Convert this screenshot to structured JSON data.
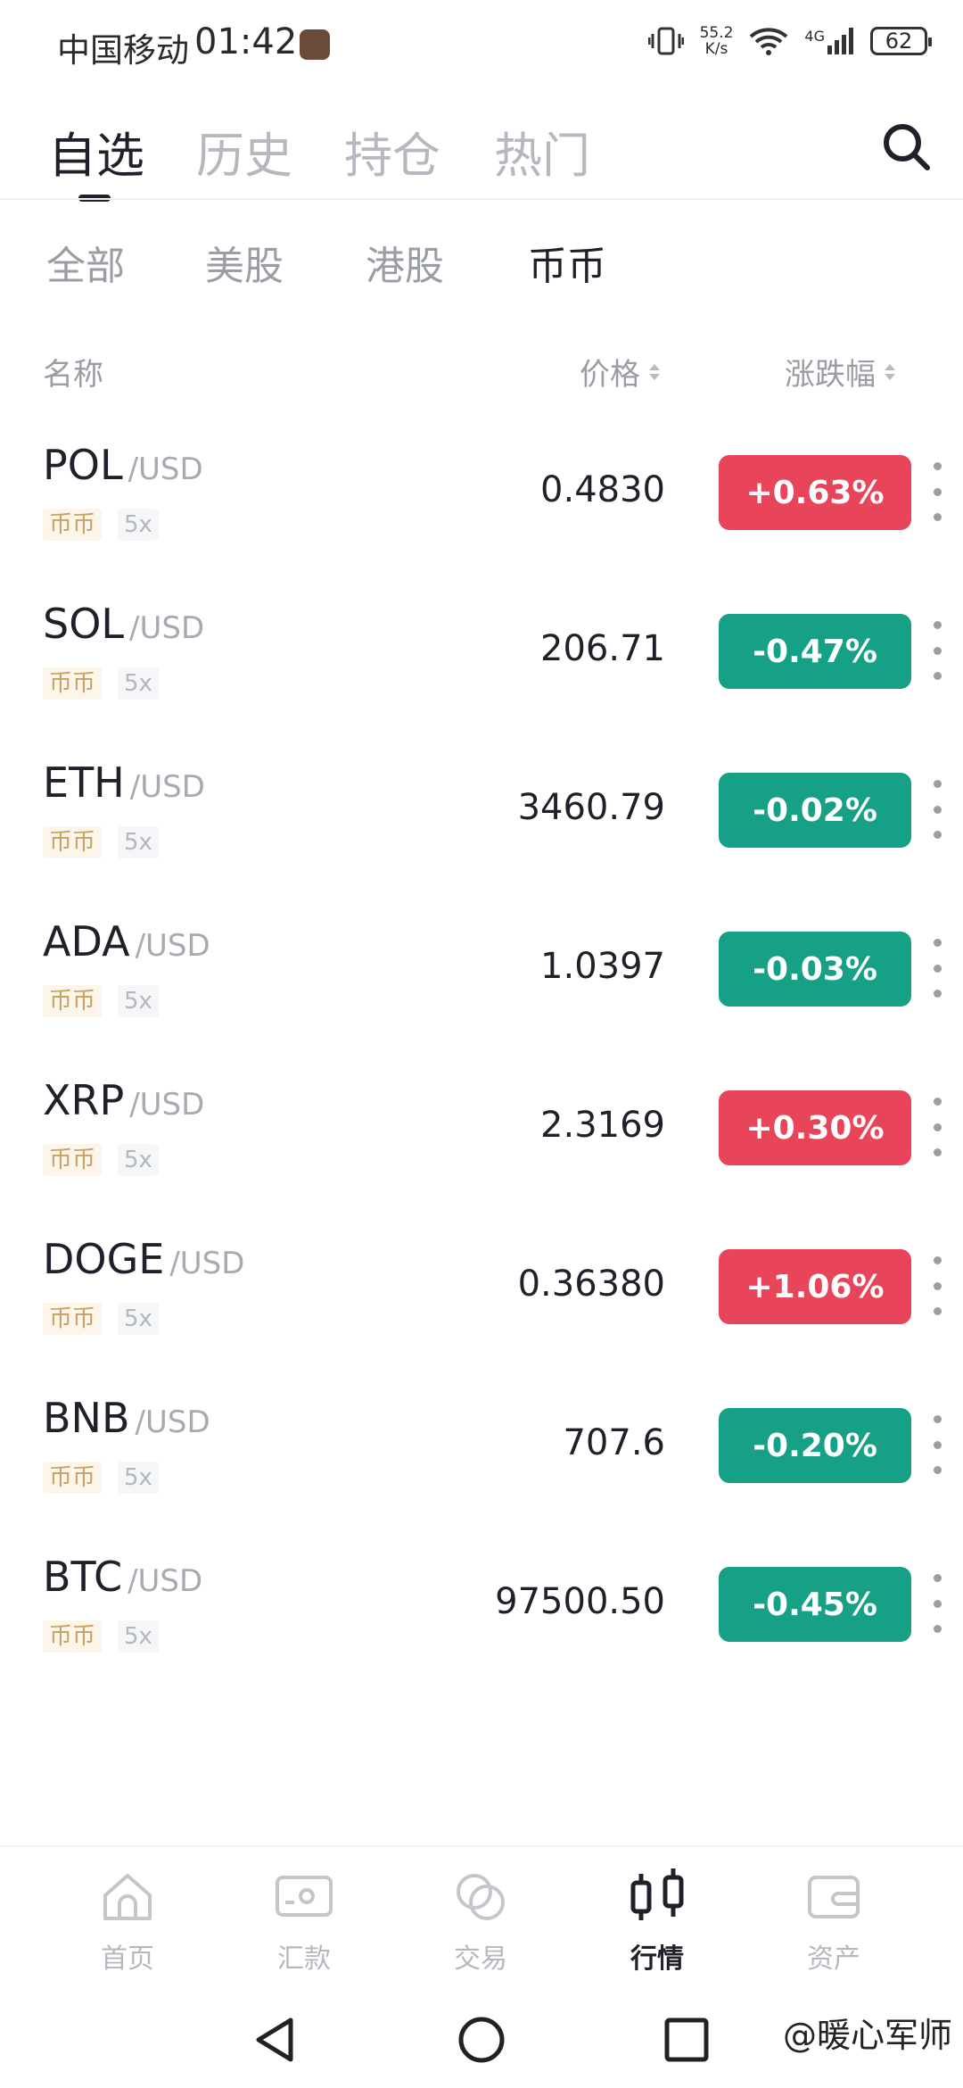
{
  "status_bar": {
    "carrier": "中国移动",
    "time": "01:42",
    "net_speed_value": "55.2",
    "net_speed_unit": "K/s",
    "network": "4G",
    "battery": "62"
  },
  "main_tabs": [
    {
      "label": "自选",
      "active": true
    },
    {
      "label": "历史",
      "active": false
    },
    {
      "label": "持仓",
      "active": false
    },
    {
      "label": "热门",
      "active": false
    }
  ],
  "sub_tabs": [
    {
      "label": "全部",
      "active": false
    },
    {
      "label": "美股",
      "active": false
    },
    {
      "label": "港股",
      "active": false
    },
    {
      "label": "币币",
      "active": true
    }
  ],
  "list_header": {
    "name": "名称",
    "price": "价格",
    "change": "涨跌幅"
  },
  "rows": [
    {
      "symbol": "POL",
      "quote": "/USD",
      "category": "币币",
      "leverage": "5x",
      "price": "0.4830",
      "change": "+0.63%",
      "direction": "up"
    },
    {
      "symbol": "SOL",
      "quote": "/USD",
      "category": "币币",
      "leverage": "5x",
      "price": "206.71",
      "change": "-0.47%",
      "direction": "down"
    },
    {
      "symbol": "ETH",
      "quote": "/USD",
      "category": "币币",
      "leverage": "5x",
      "price": "3460.79",
      "change": "-0.02%",
      "direction": "down"
    },
    {
      "symbol": "ADA",
      "quote": "/USD",
      "category": "币币",
      "leverage": "5x",
      "price": "1.0397",
      "change": "-0.03%",
      "direction": "down"
    },
    {
      "symbol": "XRP",
      "quote": "/USD",
      "category": "币币",
      "leverage": "5x",
      "price": "2.3169",
      "change": "+0.30%",
      "direction": "up"
    },
    {
      "symbol": "DOGE",
      "quote": "/USD",
      "category": "币币",
      "leverage": "5x",
      "price": "0.36380",
      "change": "+1.06%",
      "direction": "up"
    },
    {
      "symbol": "BNB",
      "quote": "/USD",
      "category": "币币",
      "leverage": "5x",
      "price": "707.6",
      "change": "-0.20%",
      "direction": "down"
    },
    {
      "symbol": "BTC",
      "quote": "/USD",
      "category": "币币",
      "leverage": "5x",
      "price": "97500.50",
      "change": "-0.45%",
      "direction": "down"
    }
  ],
  "bottom_nav": [
    {
      "label": "首页",
      "icon": "home-icon",
      "active": false
    },
    {
      "label": "汇款",
      "icon": "remit-icon",
      "active": false
    },
    {
      "label": "交易",
      "icon": "trade-icon",
      "active": false
    },
    {
      "label": "行情",
      "icon": "market-icon",
      "active": true
    },
    {
      "label": "资产",
      "icon": "wallet-icon",
      "active": false
    }
  ],
  "watermark": "@暖心军师",
  "colors": {
    "up": "#e8445a",
    "down": "#16a085",
    "accent": "#1e2129"
  }
}
